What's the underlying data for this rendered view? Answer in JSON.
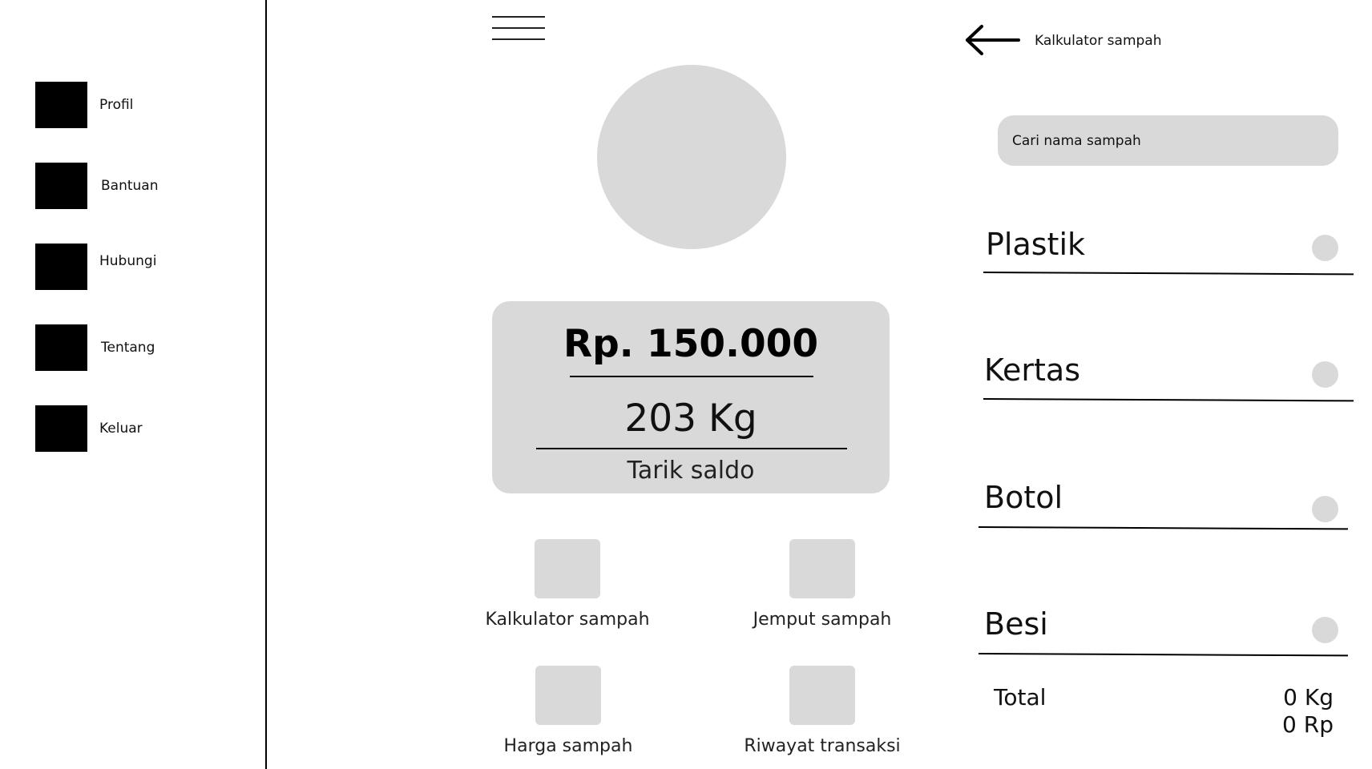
{
  "sidebar": {
    "items": [
      {
        "label": "Profil",
        "icon": "profile-icon"
      },
      {
        "label": "Bantuan",
        "icon": "help-icon"
      },
      {
        "label": "Hubungi",
        "icon": "contact-icon"
      },
      {
        "label": "Tentang",
        "icon": "about-icon"
      },
      {
        "label": "Keluar",
        "icon": "logout-icon"
      }
    ]
  },
  "home": {
    "menu_icon": "hamburger-menu-icon",
    "balance": "Rp. 150.000",
    "weight": "203 Kg",
    "withdraw_label": "Tarik saldo",
    "tiles": [
      {
        "label": "Kalkulator sampah"
      },
      {
        "label": "Jemput sampah"
      },
      {
        "label": "Harga sampah"
      },
      {
        "label": "Riwayat transaksi"
      }
    ]
  },
  "calculator": {
    "back_icon": "arrow-left-icon",
    "title": "Kalkulator sampah",
    "search_placeholder": "Cari nama sampah",
    "categories": [
      {
        "label": "Plastik"
      },
      {
        "label": "Kertas"
      },
      {
        "label": "Botol"
      },
      {
        "label": "Besi"
      }
    ],
    "total_label": "Total",
    "total_kg": "0 Kg",
    "total_rp": "0 Rp"
  },
  "colors": {
    "placeholder_gray": "#d9d9d9",
    "line": "#000000",
    "text": "#111111"
  }
}
